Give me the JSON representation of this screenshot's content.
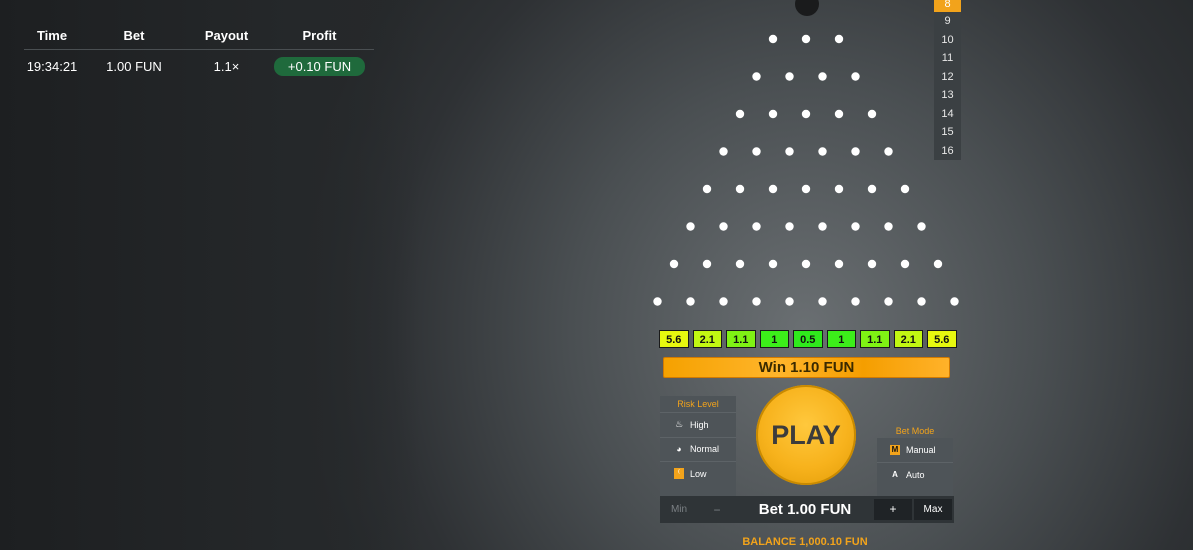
{
  "history": {
    "headers": {
      "time": "Time",
      "bet": "Bet",
      "payout": "Payout",
      "profit": "Profit"
    },
    "rows": [
      {
        "time": "19:34:21",
        "bet": "1.00 FUN",
        "payout": "1.1×",
        "profit": "+0.10 FUN"
      }
    ]
  },
  "rows_options": [
    "8",
    "9",
    "10",
    "11",
    "12",
    "13",
    "14",
    "15",
    "16"
  ],
  "selected_rows": "8",
  "multipliers": [
    {
      "label": "5.6",
      "color": "#e7f80f"
    },
    {
      "label": "2.1",
      "color": "#c2f812"
    },
    {
      "label": "1.1",
      "color": "#7ff214"
    },
    {
      "label": "1",
      "color": "#3cee1a"
    },
    {
      "label": "0.5",
      "color": "#2fea1c"
    },
    {
      "label": "1",
      "color": "#3cee1a"
    },
    {
      "label": "1.1",
      "color": "#7ff214"
    },
    {
      "label": "2.1",
      "color": "#c2f812"
    },
    {
      "label": "5.6",
      "color": "#e7f80f"
    }
  ],
  "win_banner": "Win 1.10 FUN",
  "risk": {
    "title": "Risk Level",
    "options": [
      {
        "label": "High",
        "icon": "flame-icon"
      },
      {
        "label": "Normal",
        "icon": "gauge-icon"
      },
      {
        "label": "Low",
        "icon": "leaf-icon",
        "active": true
      }
    ]
  },
  "play_label": "PLAY",
  "bet_mode": {
    "title": "Bet Mode",
    "options": [
      {
        "label": "Manual",
        "icon_letter": "M",
        "active": true
      },
      {
        "label": "Auto",
        "icon_letter": "A"
      }
    ]
  },
  "bet": {
    "min_label": "Min",
    "minus_label": "−",
    "amount": "Bet 1.00 FUN",
    "plus_label": "+",
    "max_label": "Max"
  },
  "balance": "BALANCE 1,000.10 FUN",
  "colors": {
    "accent": "#f2a31b",
    "profit_green": "#1f6a3c"
  }
}
